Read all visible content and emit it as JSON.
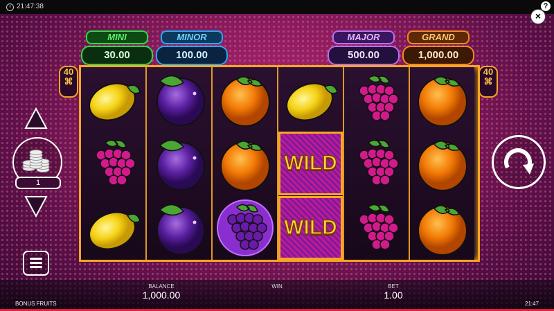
{
  "topbar": {
    "time": "21:47:38",
    "help_label": "?",
    "close_label": "×"
  },
  "jackpots": [
    {
      "label": "MINI",
      "value": "30.00",
      "color": "#2fd84a"
    },
    {
      "label": "MINOR",
      "value": "100.00",
      "color": "#29a8f5"
    },
    {
      "label": "MAJOR",
      "value": "500.00",
      "color": "#b770ef"
    },
    {
      "label": "GRAND",
      "value": "1,000.00",
      "color": "#f58a1e"
    }
  ],
  "ways": {
    "left_number": "40",
    "right_number": "40",
    "icon": "ways-icon"
  },
  "reels": [
    [
      "lemon",
      "grapes",
      "lemon"
    ],
    [
      "plum",
      "plum",
      "plum"
    ],
    [
      "orange",
      "orange",
      "grapes-bonus"
    ],
    [
      "lemon",
      "wild",
      "wild"
    ],
    [
      "grapes",
      "grapes",
      "grapes"
    ],
    [
      "orange",
      "orange",
      "orange"
    ]
  ],
  "wild_label": "WILD",
  "bet_level": "1",
  "controls": {
    "up_icon": "triangle-up-icon",
    "down_icon": "triangle-down-icon",
    "coins_icon": "coin-stack-icon",
    "spin_icon": "spin-arrow-icon",
    "menu_icon": "hamburger-icon"
  },
  "bottom": {
    "balance_label": "BALANCE",
    "balance_value": "1,000.00",
    "win_label": "WIN",
    "win_value": "",
    "bet_label": "BET",
    "bet_value": "1.00",
    "game_name": "BONUS FRUITS",
    "time": "21:47"
  }
}
